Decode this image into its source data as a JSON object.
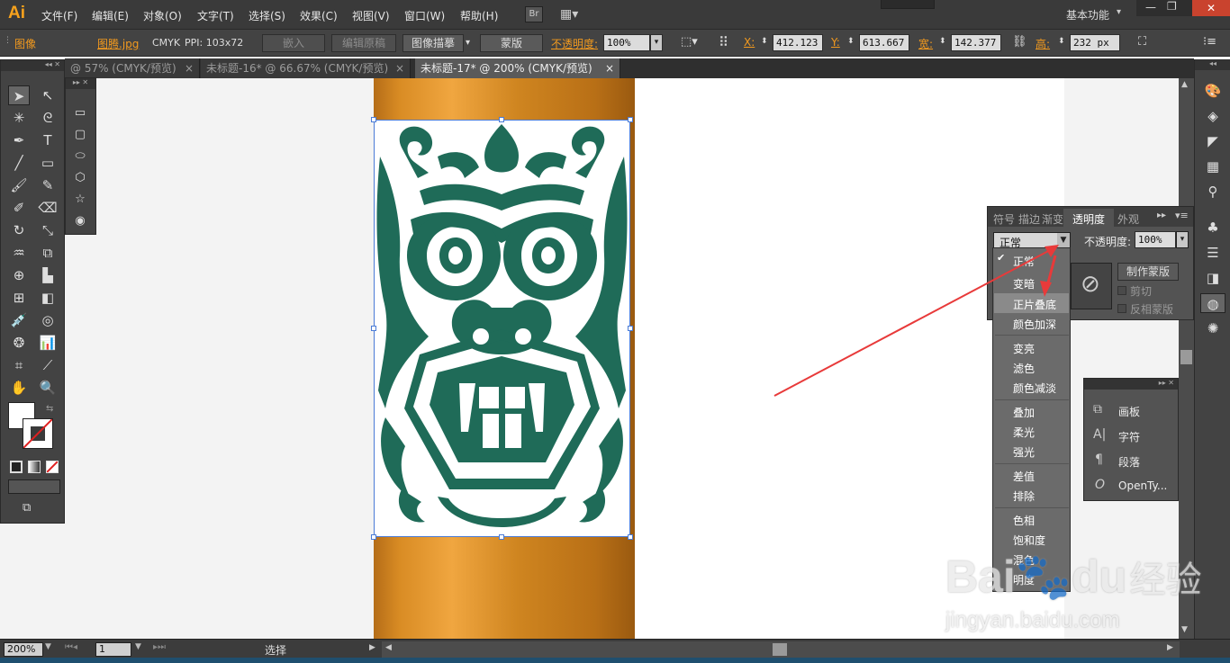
{
  "app": {
    "logo": "Ai",
    "workspace": "基本功能",
    "bridge": "Br"
  },
  "menus": [
    "文件(F)",
    "编辑(E)",
    "对象(O)",
    "文字(T)",
    "选择(S)",
    "效果(C)",
    "视图(V)",
    "窗口(W)",
    "帮助(H)"
  ],
  "control": {
    "kind": "图像",
    "file": "图腾.jpg",
    "mode": "CMYK",
    "ppi": "PPI: 103x72",
    "embed": "嵌入",
    "edit_original": "编辑原稿",
    "trace": "图像描摹",
    "mask": "蒙版",
    "opacity_label": "不透明度:",
    "opacity": "100%",
    "x_label": "X:",
    "x": "412.123",
    "y_label": "Y:",
    "y": "613.667",
    "w_label": "宽:",
    "w": "142.377",
    "h_label": "高:",
    "h": "232 px"
  },
  "tabs": [
    {
      "label": "@ 57% (CMYK/预览)"
    },
    {
      "label": "未标题-16* @ 66.67% (CMYK/预览)"
    },
    {
      "label": "未标题-17* @ 200% (CMYK/预览)"
    }
  ],
  "tab_close": "×",
  "transparency": {
    "tabs": [
      "符号",
      "描边",
      "渐变",
      "透明度",
      "外观"
    ],
    "blend_mode": "正常",
    "opacity_label": "不透明度:",
    "opacity": "100%",
    "make_mask": "制作蒙版",
    "clip": "剪切",
    "invert": "反相蒙版"
  },
  "blend_groups": [
    [
      "正常",
      "变暗",
      "正片叠底",
      "颜色加深"
    ],
    [
      "变亮",
      "滤色",
      "颜色减淡"
    ],
    [
      "叠加",
      "柔光",
      "强光"
    ],
    [
      "差值",
      "排除"
    ],
    [
      "色相",
      "饱和度",
      "混色",
      "明度"
    ]
  ],
  "side_panel": [
    "画板",
    "字符",
    "段落",
    "OpenTy..."
  ],
  "status": {
    "zoom": "200%",
    "page": "1",
    "mode": "选择"
  },
  "watermark": {
    "brand": "Bai",
    "brand2": "du",
    "cn": "经验",
    "url": "jingyan.baidu.com"
  },
  "colors": {
    "accent": "#f39a1e",
    "mark": "#1f6b58",
    "arrow": "#e83a3a"
  }
}
